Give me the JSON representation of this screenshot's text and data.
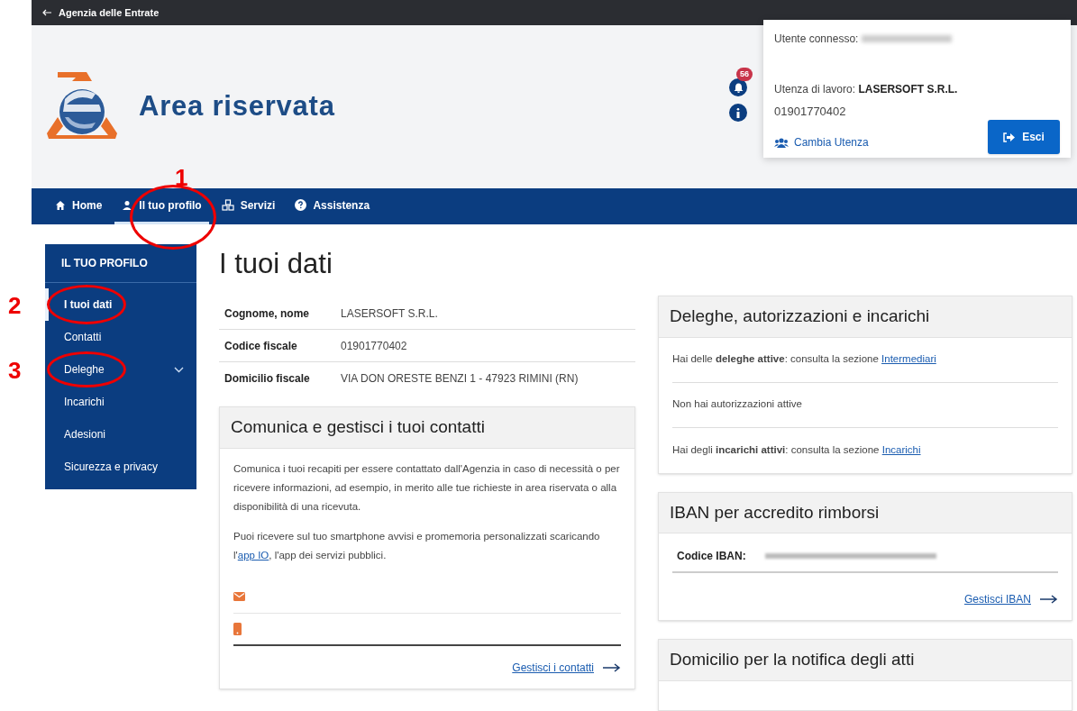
{
  "top_bar": {
    "title": "Agenzia delle Entrate"
  },
  "header": {
    "title": "Area riservata",
    "notification_count": "56",
    "user_card": {
      "connected_label": "Utente connesso:",
      "work_label": "Utenza di lavoro:",
      "work_name": "LASERSOFT S.R.L.",
      "work_code": "01901770402",
      "switch_link": "Cambia Utenza",
      "logout_button": "Esci"
    }
  },
  "nav": [
    {
      "label": "Home",
      "kind": "home",
      "selected": false
    },
    {
      "label": "Il tuo profilo",
      "kind": "user",
      "selected": true
    },
    {
      "label": "Servizi",
      "kind": "services",
      "selected": false
    },
    {
      "label": "Assistenza",
      "kind": "help",
      "selected": false
    }
  ],
  "sidebar": {
    "title": "IL TUO PROFILO",
    "items": [
      {
        "label": "I tuoi dati",
        "selected": true,
        "has_submenu": false
      },
      {
        "label": "Contatti",
        "selected": false,
        "has_submenu": false
      },
      {
        "label": "Deleghe",
        "selected": false,
        "has_submenu": true
      },
      {
        "label": "Incarichi",
        "selected": false,
        "has_submenu": false
      },
      {
        "label": "Adesioni",
        "selected": false,
        "has_submenu": false
      },
      {
        "label": "Sicurezza e privacy",
        "selected": false,
        "has_submenu": false
      }
    ]
  },
  "page_title": "I tuoi dati",
  "data_rows": [
    {
      "label": "Cognome, nome",
      "value": "LASERSOFT S.R.L."
    },
    {
      "label": "Codice fiscale",
      "value": "01901770402"
    },
    {
      "label": "Domicilio fiscale",
      "value": "VIA DON ORESTE BENZI 1 - 47923 RIMINI (RN)"
    }
  ],
  "contacts_card": {
    "title": "Comunica e gestisci i tuoi contatti",
    "paragraph": "Comunica i tuoi recapiti per essere contattato dall'Agenzia in caso di necessità o per ricevere informazioni, ad esempio, in merito alle tue richieste in area riservata o alla disponibilità di una ricevuta.",
    "app_text_before": "Puoi ricevere sul tuo smartphone avvisi e promemoria personalizzati scaricando l'",
    "app_link": "app IO",
    "app_text_after": ", l'app dei servizi pubblici.",
    "contacts": [
      {
        "kind": "email"
      },
      {
        "kind": "phone"
      }
    ],
    "action_link": "Gestisci i contatti"
  },
  "delegations_card": {
    "title": "Deleghe, autorizzazioni e incarichi",
    "rows": [
      {
        "text": "Hai delle **deleghe attive**: consulta la sezione",
        "link": "Intermediari"
      },
      {
        "text": "Non hai autorizzazioni attive"
      },
      {
        "text": "Hai degli **incarichi attivi**: consulta la sezione",
        "link": "Incarichi"
      }
    ]
  },
  "iban_card": {
    "title": "IBAN per accredito rimborsi",
    "label": "Codice IBAN:",
    "action_link": "Gestisci IBAN"
  },
  "domicile_card": {
    "title": "Domicilio per la notifica degli atti"
  },
  "annotations": [
    {
      "label": "1"
    },
    {
      "label": "2"
    },
    {
      "label": "3"
    }
  ]
}
